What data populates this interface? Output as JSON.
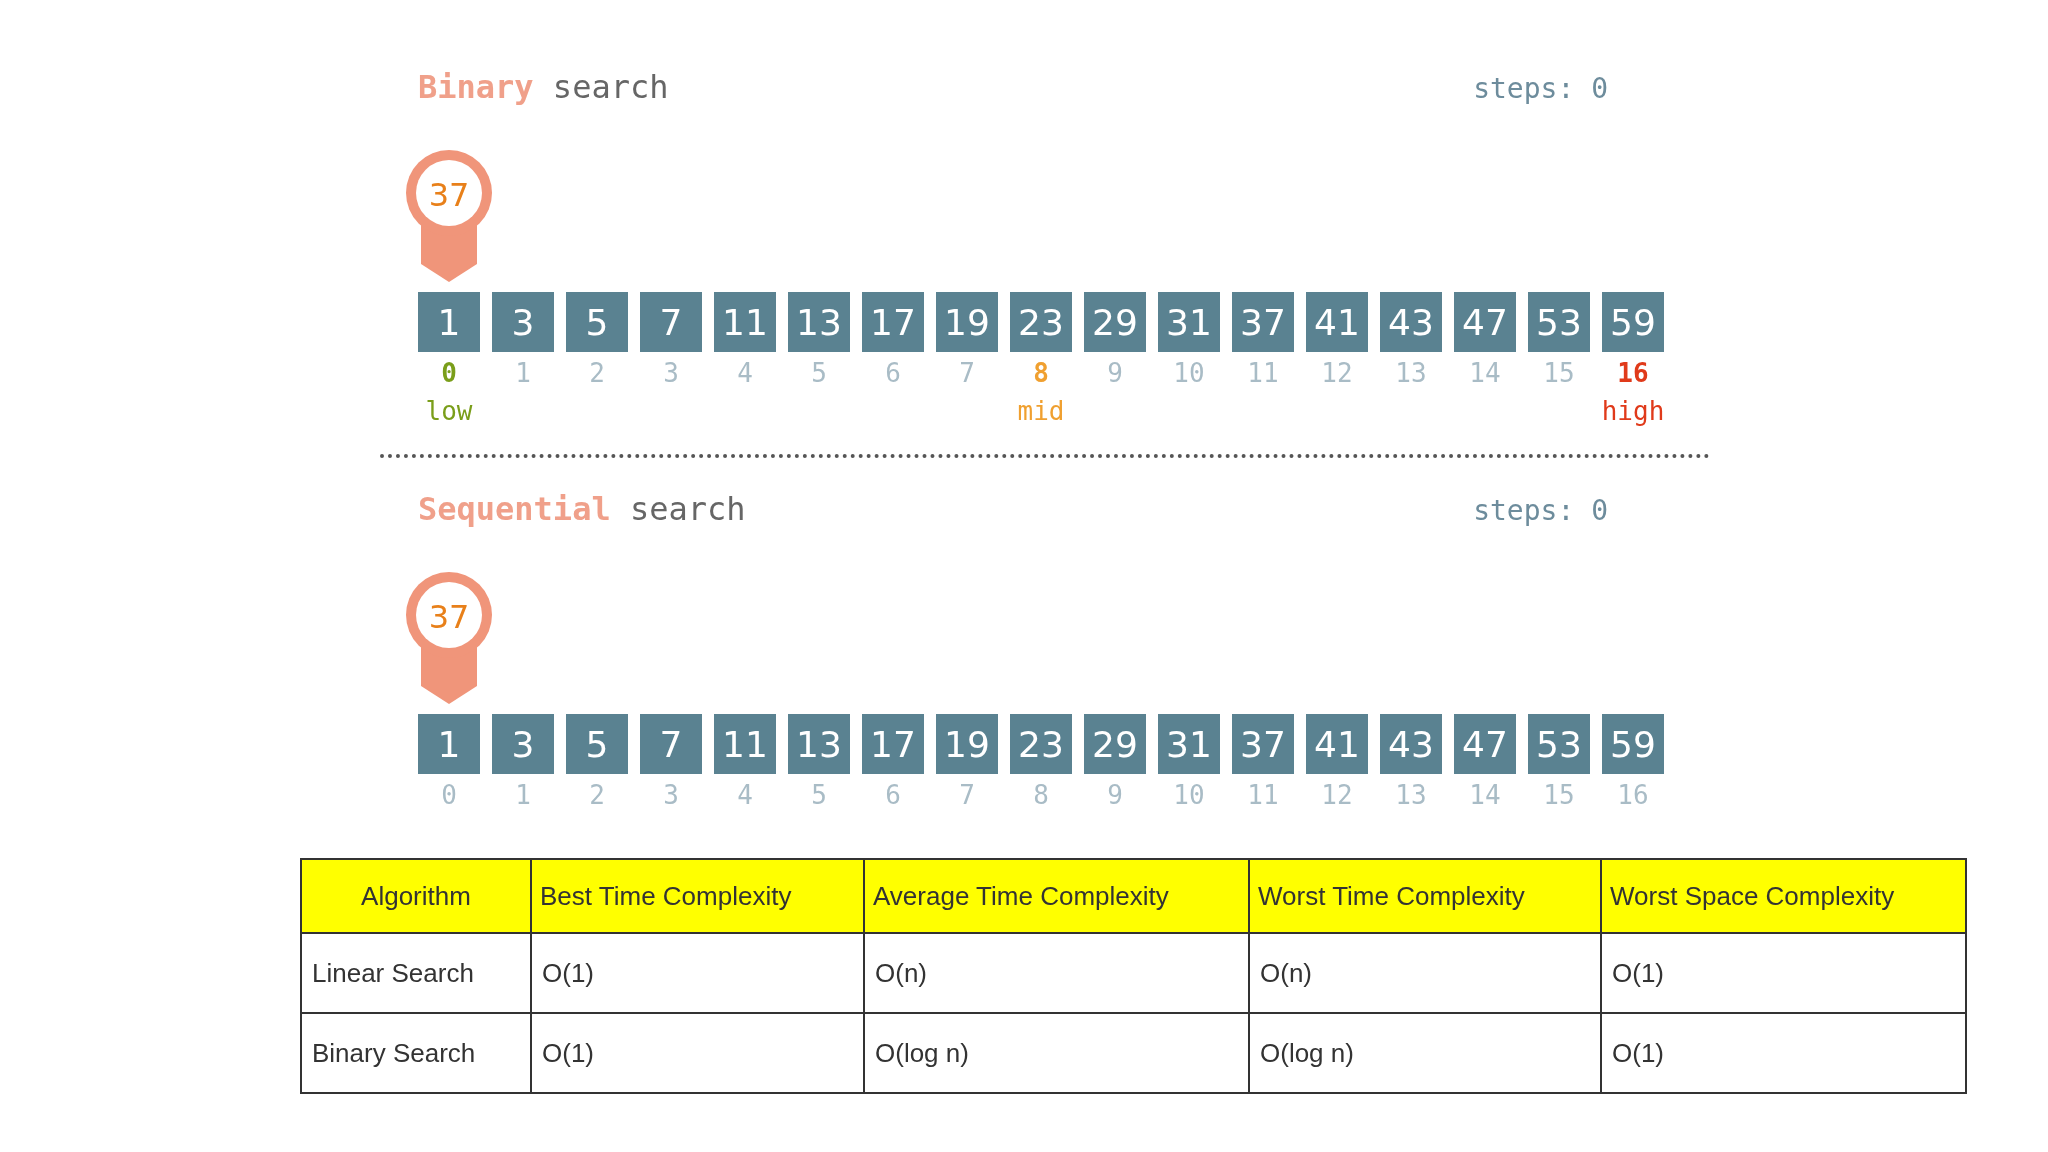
{
  "searches": [
    {
      "title_highlight": "Binary",
      "title_rest": "search",
      "steps_label": "steps:",
      "steps_value": "0",
      "target": "37",
      "cells": [
        {
          "value": "1",
          "index": "0",
          "current": true,
          "marker": {
            "kind": "low",
            "label": "low"
          }
        },
        {
          "value": "3",
          "index": "1",
          "current": false
        },
        {
          "value": "5",
          "index": "2",
          "current": false
        },
        {
          "value": "7",
          "index": "3",
          "current": false
        },
        {
          "value": "11",
          "index": "4",
          "current": false
        },
        {
          "value": "13",
          "index": "5",
          "current": false
        },
        {
          "value": "17",
          "index": "6",
          "current": false
        },
        {
          "value": "19",
          "index": "7",
          "current": false
        },
        {
          "value": "23",
          "index": "8",
          "current": false,
          "marker": {
            "kind": "mid",
            "label": "mid"
          }
        },
        {
          "value": "29",
          "index": "9",
          "current": false
        },
        {
          "value": "31",
          "index": "10",
          "current": false
        },
        {
          "value": "37",
          "index": "11",
          "current": false
        },
        {
          "value": "41",
          "index": "12",
          "current": false
        },
        {
          "value": "43",
          "index": "13",
          "current": false
        },
        {
          "value": "47",
          "index": "14",
          "current": false
        },
        {
          "value": "53",
          "index": "15",
          "current": false
        },
        {
          "value": "59",
          "index": "16",
          "current": false,
          "marker": {
            "kind": "high",
            "label": "high"
          }
        }
      ]
    },
    {
      "title_highlight": "Sequential",
      "title_rest": "search",
      "steps_label": "steps:",
      "steps_value": "0",
      "target": "37",
      "cells": [
        {
          "value": "1",
          "index": "0",
          "current": true
        },
        {
          "value": "3",
          "index": "1",
          "current": false
        },
        {
          "value": "5",
          "index": "2",
          "current": false
        },
        {
          "value": "7",
          "index": "3",
          "current": false
        },
        {
          "value": "11",
          "index": "4",
          "current": false
        },
        {
          "value": "13",
          "index": "5",
          "current": false
        },
        {
          "value": "17",
          "index": "6",
          "current": false
        },
        {
          "value": "19",
          "index": "7",
          "current": false
        },
        {
          "value": "23",
          "index": "8",
          "current": false
        },
        {
          "value": "29",
          "index": "9",
          "current": false
        },
        {
          "value": "31",
          "index": "10",
          "current": false
        },
        {
          "value": "37",
          "index": "11",
          "current": false
        },
        {
          "value": "41",
          "index": "12",
          "current": false
        },
        {
          "value": "43",
          "index": "13",
          "current": false
        },
        {
          "value": "47",
          "index": "14",
          "current": false
        },
        {
          "value": "53",
          "index": "15",
          "current": false
        },
        {
          "value": "59",
          "index": "16",
          "current": false
        }
      ]
    }
  ],
  "table": {
    "columns": [
      "Algorithm",
      "Best Time Complexity",
      "Average Time Complexity",
      "Worst Time Complexity",
      "Worst Space Complexity"
    ],
    "rows": [
      [
        "Linear Search",
        "O(1)",
        "O(n)",
        "O(n)",
        "O(1)"
      ],
      [
        "Binary Search",
        "O(1)",
        "O(log n)",
        "O(log n)",
        "O(1)"
      ]
    ]
  }
}
